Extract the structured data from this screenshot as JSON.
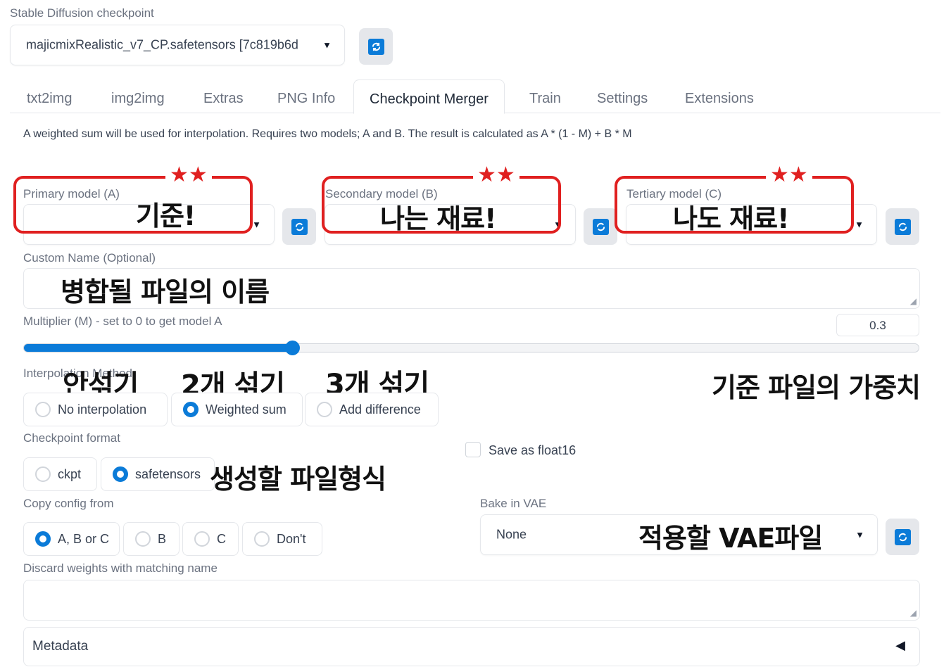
{
  "checkpoint": {
    "label": "Stable Diffusion checkpoint",
    "value": "majicmixRealistic_v7_CP.safetensors [7c819b6d"
  },
  "tabs": [
    "txt2img",
    "img2img",
    "Extras",
    "PNG Info",
    "Checkpoint Merger",
    "Train",
    "Settings",
    "Extensions"
  ],
  "active_tab": "Checkpoint Merger",
  "description": "A weighted sum will be used for interpolation. Requires two models; A and B. The result is calculated as A * (1 - M) + B * M",
  "models": {
    "primary_label": "Primary model (A)",
    "secondary_label": "Secondary model (B)",
    "tertiary_label": "Tertiary model (C)"
  },
  "custom_name": {
    "label": "Custom Name (Optional)",
    "value": ""
  },
  "multiplier": {
    "label": "Multiplier (M) - set to 0 to get model A",
    "value": "0.3",
    "fraction": 0.3
  },
  "interpolation": {
    "label": "Interpolation Method",
    "options": [
      "No interpolation",
      "Weighted sum",
      "Add difference"
    ],
    "selected": "Weighted sum"
  },
  "format": {
    "label": "Checkpoint format",
    "options": [
      "ckpt",
      "safetensors"
    ],
    "selected": "safetensors"
  },
  "float16": {
    "label": "Save as float16",
    "checked": false
  },
  "copy_config": {
    "label": "Copy config from",
    "options": [
      "A, B or C",
      "B",
      "C",
      "Don't"
    ],
    "selected": "A, B or C"
  },
  "vae": {
    "label": "Bake in VAE",
    "value": "None"
  },
  "discard": {
    "label": "Discard weights with matching name",
    "value": ""
  },
  "metadata": {
    "label": "Metadata"
  },
  "annotations": {
    "primary": "기준!",
    "secondary": "나는 재료!",
    "tertiary": "나도 재료!",
    "custom_name": "병합될 파일의 이름",
    "no_interp": "안섞기",
    "weighted": "2개 섞기",
    "add_diff": "3개 섞기",
    "multiplier": "기준 파일의 가중치",
    "format": "생성할 파일형식",
    "vae": "적용할 VAE파일",
    "stars": "★★"
  },
  "colors": {
    "accent": "#0b7bd8",
    "annotation_red": "#e02020"
  }
}
